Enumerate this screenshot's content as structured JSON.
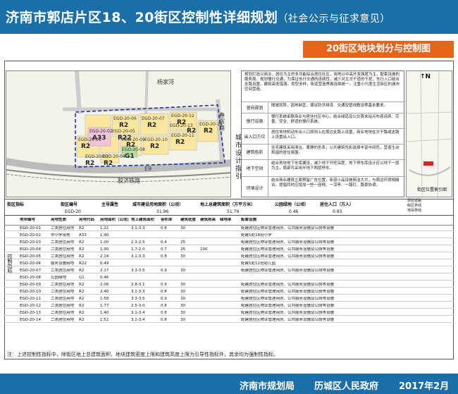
{
  "header": {
    "title": "济南市郭店片区18、20街区控制性详细规划",
    "subtitle": "（社会公示与征求意见）"
  },
  "subheader": "20街区地块划分与控制图",
  "map": {
    "plots": [
      {
        "label": "EGD-20-01",
        "code": "R2"
      },
      {
        "label": "EGD-20-02",
        "code": "A33"
      },
      {
        "label": "EGD-20-03",
        "code": "R2"
      },
      {
        "label": "EGD-20-04",
        "code": "R2"
      },
      {
        "label": "EGD-20-05",
        "code": "R22"
      },
      {
        "label": "EGD-20-06",
        "code": "R2"
      },
      {
        "label": "EGD-20-07",
        "code": "R2"
      },
      {
        "label": "EGD-20-08",
        "code": "G1"
      },
      {
        "label": "EGD-20-09",
        "code": "R2"
      },
      {
        "label": "EGD-20-10",
        "code": "R2"
      },
      {
        "label": "EGD-20-11",
        "code": "R2"
      },
      {
        "label": "EGD-20-12",
        "code": "R2"
      },
      {
        "label": "EGD-20-13",
        "code": "R2"
      },
      {
        "label": "EGD-20-14",
        "code": "R2"
      }
    ],
    "roads": {
      "r1": "杨家河",
      "r2": "E9",
      "r3": "胶济铁路",
      "r4": "春晖路"
    }
  },
  "guide_title": "城市设计指引",
  "guide": [
    {
      "key": "",
      "value": "规划打造以商业、居住为主的多功能综合居住社区，用地以中高开发强度为主，配套设施的服务局，规划慢行交通，为保证车行交通的连续性，减少对主次干道的干扰，车行入口结合支路设置。建筑高低错落，类型多样，街道营造界面连续统一，注重小尺度生活街区的城市空间营造。"
    },
    {
      "key": "竖向规划",
      "value": "随坡就势，因地制宜，满足防洪排涝、交通及管线敷设等基本要求。"
    },
    {
      "key": "慢行设施",
      "value": "慢行系统串联商业与居住社区中心，结合绿道及公交首末站点布局连续、完善、安全、舒适的慢行系统。"
    },
    {
      "key": "出入口方位",
      "value": "居住地块机动车出入口原则上在周边支路上设置，商业地块在次干路或支路上设置出入口。"
    },
    {
      "key": "建筑色彩",
      "value": "住宅建筑采用清淡、柔静的色系；公共建筑色彩选择丰富中间色，营造生动和谐的居住氛围。"
    },
    {
      "key": "地下空间",
      "value": "结合地块地下车库建设，减少地下开挖深度，地下停车库设计应以地下一层为主，局部可采用半地下两层停车。"
    },
    {
      "key": "环境设计",
      "value": "结合商业建筑立面预留广告位置，街道小品设施简洁大方，与周边环境相融合，提倡同时应增加一些一座椅、一凉亭、一路灯、路景协调。"
    }
  ],
  "locmap_label": "街区位置索引图",
  "legend": [
    "规划道路",
    "街区界线",
    "地块界线"
  ],
  "index": {
    "headers": [
      "街区指标",
      "街区编号",
      "主导属性",
      "城市建设用地面积（公顷）",
      "地上总建筑面积（万平方米）",
      "公园绿地（公顷）",
      "居住人口（万人）"
    ],
    "values": [
      "",
      "EGD-20",
      "",
      "31.96",
      "51.79",
      "0.46",
      "0.93"
    ]
  },
  "table": {
    "headers": [
      "地块编号",
      "用地性质",
      "用地代码",
      "用地面积（公顷）",
      "地上建筑面积",
      "容积率",
      "建筑密度",
      "建筑限高",
      "绿地率",
      "配套设施",
      "备注"
    ],
    "rows": [
      [
        "EGD-20-01",
        "二类居住用地",
        "R2",
        "1.22",
        "3.1-3.3",
        "0.8",
        "30",
        "",
        "",
        "配建居住区物业管理用房、公共服务设施及公厕等设施"
      ],
      [
        "EGD-20-02",
        "中小学用地",
        "A33",
        "1.90",
        "",
        "",
        "",
        "",
        "",
        "配建1处18班小学"
      ],
      [
        "EGD-20-03",
        "二类居住用地",
        "R2",
        "1.00",
        "2.3-2.5",
        "0.4",
        "25",
        "",
        "",
        "配建居住区物业管理用房、公共服务设施及公厕等设施"
      ],
      [
        "EGD-20-04",
        "二类居住用地",
        "R2",
        "1.90",
        "1.7-2.0",
        "0.7",
        "25",
        "100",
        "",
        "配建居住区物业管理用房、公共服务设施及公厕等设施"
      ],
      [
        "EGD-20-05",
        "二类居住用地",
        "R2",
        "2.14",
        "3.1-3.3",
        "0.8",
        "30",
        "",
        "",
        "配建居住区物业管理用房、公共服务设施及公厕等设施"
      ],
      [
        "EGD-20-06",
        "服务设施用地",
        "R22",
        "0.49",
        "",
        "",
        "",
        "",
        "",
        "配建1处12班幼儿园"
      ],
      [
        "EGD-20-07",
        "二类居住用地",
        "R2",
        "2.17",
        "3.3-3.5",
        "0.9",
        "30",
        "",
        "",
        "配建居住区物业管理用房、公共服务设施及公厕等设施"
      ],
      [
        "EGD-20-08",
        "公园绿地",
        "G1",
        "0.46",
        "",
        "",
        "",
        "",
        "",
        ""
      ],
      [
        "EGD-20-09",
        "二类居住用地",
        "R2",
        "2.06",
        "2.8-3.1",
        "0.9",
        "30",
        "",
        "",
        "配建居住区物业管理用房、公共服务设施及公厕等设施"
      ],
      [
        "EGD-20-10",
        "二类居住用地",
        "R2",
        "2.40",
        "3.1-3.3",
        "0.8",
        "30",
        "",
        "",
        "配建居住区物业管理用房、公共服务设施及公厕等设施"
      ],
      [
        "EGD-20-11",
        "二类居住用地",
        "R2",
        "1.58",
        "3.3-3.5",
        "0.9",
        "30",
        "",
        "",
        "配建居住区物业管理用房、公共服务设施及公厕等设施"
      ],
      [
        "EGD-20-12",
        "二类居住用地",
        "R2",
        "1.77",
        "2.5-3.0",
        "0.8",
        "30",
        "",
        "",
        "配建居住区物业管理用房、公共服务设施及公厕等设施"
      ],
      [
        "EGD-20-13",
        "二类居住用地",
        "R2",
        "1.40",
        "3.1-3.4",
        "0.8",
        "30",
        "",
        "",
        "配建居住区物业管理用房、公共服务设施及公厕等设施"
      ],
      [
        "EGD-20-14",
        "二类居住用地",
        "R2",
        "1.52",
        "3.1-3.4",
        "0.8",
        "30",
        "",
        "",
        "配建居住区物业管理用房、公共服务设施及公厕等设施"
      ]
    ]
  },
  "side_label": "控制指标",
  "note": "注：上述控制性指标中，除街区地上总建筑面积、地块建筑密度上限和建筑高度上限为引导性指标外，其余均为强制性指标。",
  "footer": {
    "left": "济南市规划局",
    "middle": "历城区人民政府",
    "right": "2017年2月"
  }
}
